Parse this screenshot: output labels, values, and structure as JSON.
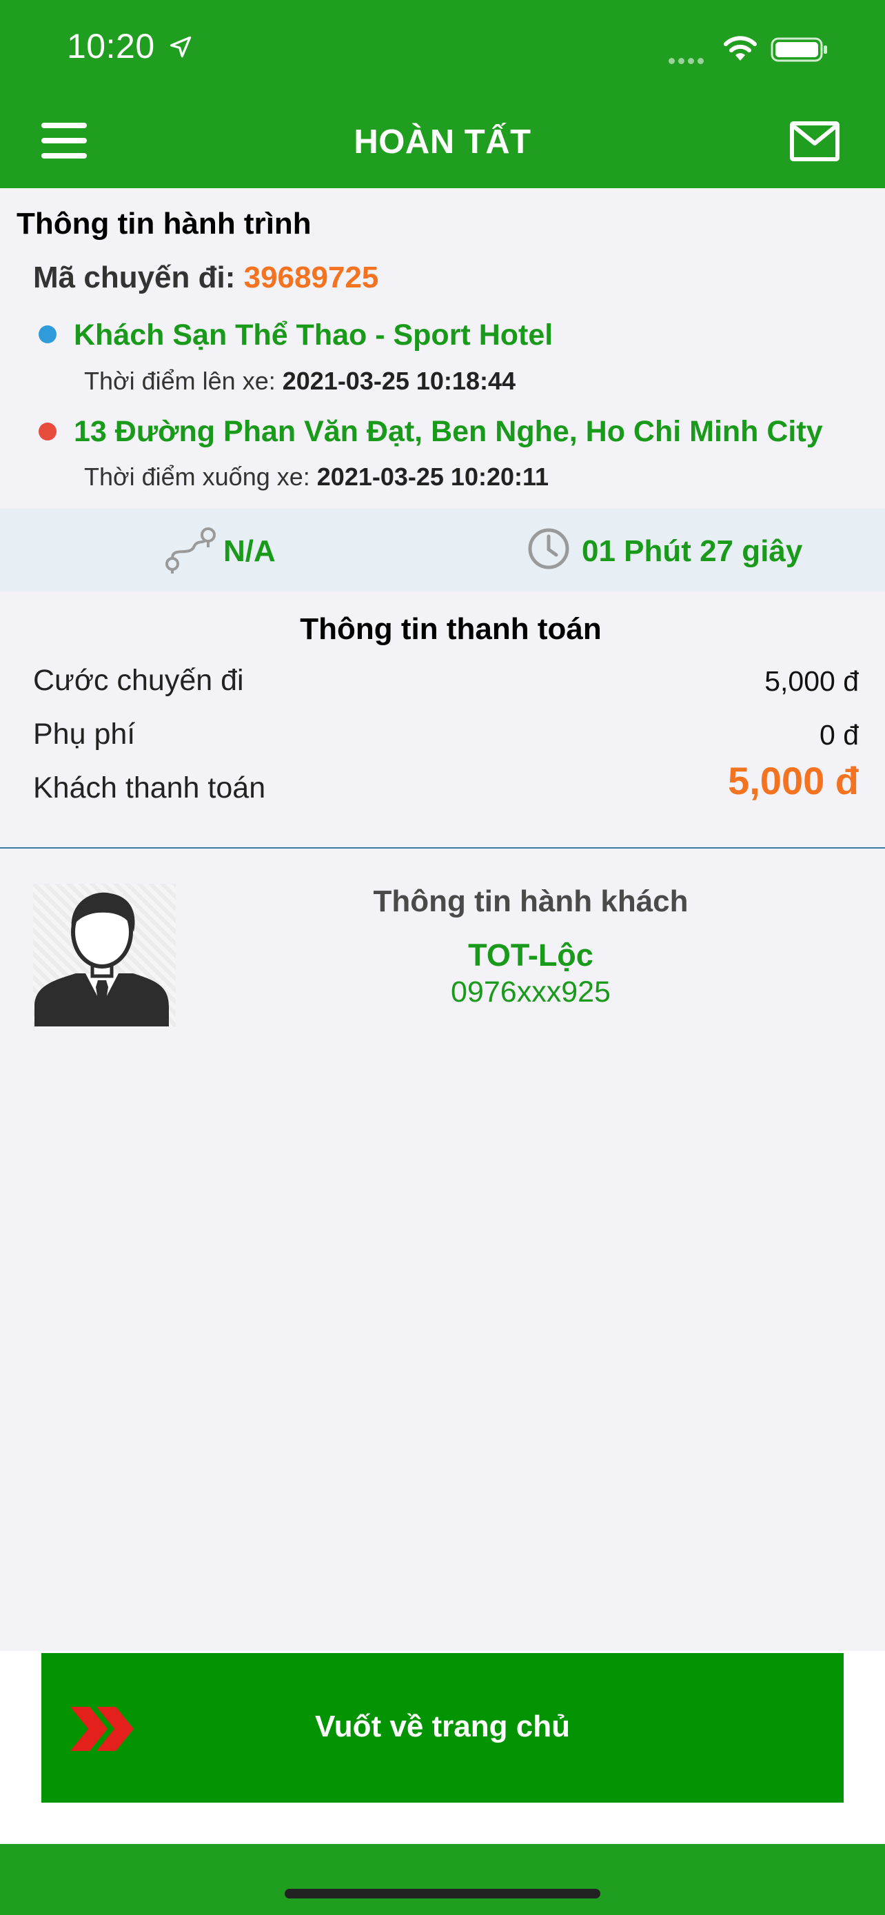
{
  "status_bar": {
    "time": "10:20"
  },
  "header": {
    "title": "HOÀN TẤT"
  },
  "trip": {
    "section_title": "Thông tin hành trình",
    "code_label": "Mã chuyến đi:",
    "code_value": "39689725",
    "pickup": {
      "place": "Khách Sạn Thể Thao - Sport Hotel",
      "time_label": "Thời điểm lên xe:",
      "time_value": "2021-03-25 10:18:44",
      "dot_color": "#2f9bd8"
    },
    "dropoff": {
      "place": "13 Đường Phan Văn Đạt, Ben Nghe, Ho Chi Minh City",
      "time_label": "Thời điểm xuống xe:",
      "time_value": "2021-03-25 10:20:11",
      "dot_color": "#e84c3d"
    }
  },
  "stats": {
    "distance": "N/A",
    "duration": "01 Phút 27 giây"
  },
  "payment": {
    "title": "Thông tin thanh toán",
    "rows": [
      {
        "label": "Cước chuyến đi",
        "value": "5,000 đ"
      },
      {
        "label": "Phụ phí",
        "value": "0 đ"
      },
      {
        "label": "Khách thanh toán",
        "value": "5,000 đ"
      }
    ]
  },
  "passenger": {
    "title": "Thông tin hành khách",
    "name": "TOT-Lộc",
    "phone": "0976xxx925"
  },
  "footer": {
    "swipe_label": "Vuốt về trang chủ"
  },
  "colors": {
    "brand_green": "#1f9e1f",
    "button_green": "#029402",
    "accent_orange": "#f37321",
    "text_green": "#1a9a1a"
  }
}
